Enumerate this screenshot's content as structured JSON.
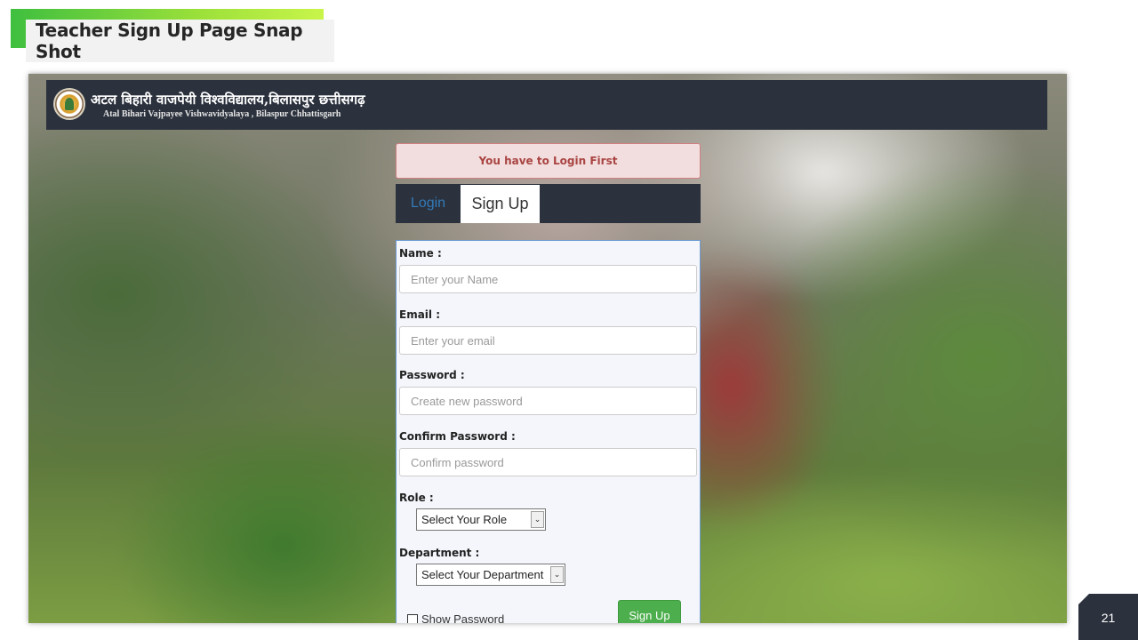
{
  "slide": {
    "title": "Teacher Sign Up Page Snap Shot",
    "page_number": "21"
  },
  "header": {
    "university_hindi": "अटल बिहारी वाजपेयी विश्वविद्यालय,बिलासपुर छत्तीसगढ़",
    "university_english": "Atal Bihari Vajpayee Vishwavidyalaya , Bilaspur Chhattisgarh",
    "logo_icon": "university-emblem-icon"
  },
  "alert": {
    "message": "You have to Login First",
    "color": "#a94442",
    "background": "#f2dede"
  },
  "tabs": [
    {
      "label": "Login",
      "active": false
    },
    {
      "label": "Sign Up",
      "active": true
    }
  ],
  "form": {
    "name_label": "Name :",
    "name_placeholder": "Enter your Name",
    "email_label": "Email :",
    "email_placeholder": "Enter your email",
    "password_label": "Password :",
    "password_placeholder": "Create new password",
    "confirm_label": "Confirm Password :",
    "confirm_placeholder": "Confirm password",
    "role_label": "Role :",
    "role_selected": "Select Your Role",
    "department_label": "Department :",
    "department_selected": "Select Your Department",
    "show_password_label": "Show Password",
    "show_password_checked": false,
    "submit_label": "Sign Up",
    "submit_color": "#4cae4c"
  },
  "colors": {
    "header_bg": "#2b313d",
    "link_blue": "#337ab7",
    "title_accent": "#9be03a"
  }
}
